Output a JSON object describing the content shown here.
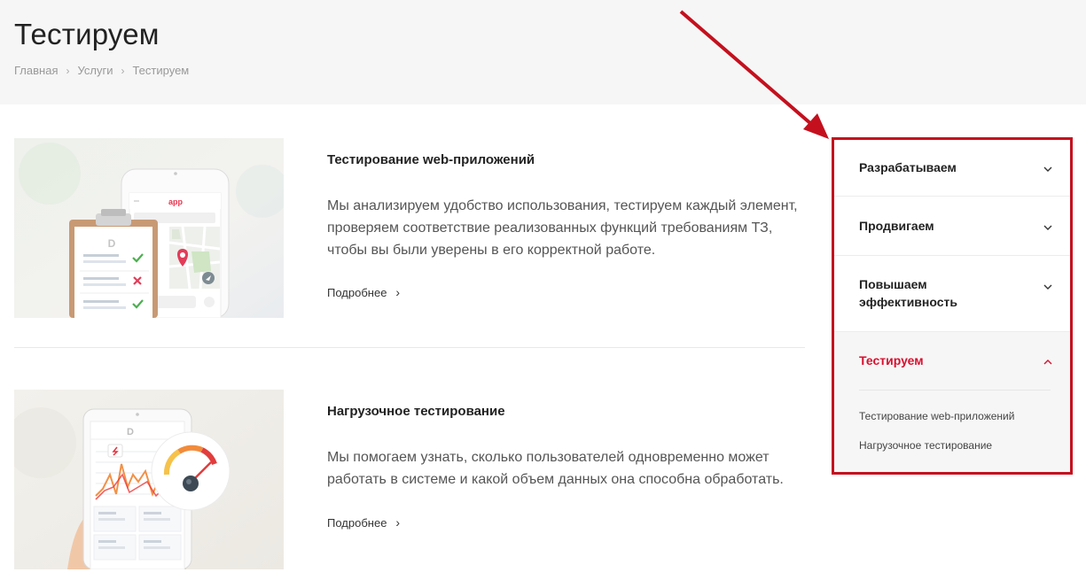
{
  "page": {
    "title": "Тестируем",
    "breadcrumb": [
      "Главная",
      "Услуги",
      "Тестируем"
    ]
  },
  "cards": [
    {
      "title": "Тестирование web-приложений",
      "description": "Мы анализируем удобство использования, тестируем каждый элемент, проверяем соответствие реализованных функций требованиям ТЗ, чтобы вы были уверены в его корректной работе.",
      "more_label": "Подробнее",
      "image_text": "app"
    },
    {
      "title": "Нагрузочное тестирование",
      "description": "Мы помогаем узнать, сколько пользователей одновременно может работать в системе и какой объем данных она способна обработать.",
      "more_label": "Подробнее"
    }
  ],
  "sidebar": {
    "items": [
      {
        "label": "Разрабатываем",
        "expanded": false
      },
      {
        "label": "Продвигаем",
        "expanded": false
      },
      {
        "label": "Повышаем эффективность",
        "expanded": false
      },
      {
        "label": "Тестируем",
        "expanded": true
      }
    ],
    "sub_items": [
      "Тестирование web-приложений",
      "Нагрузочное тестирование"
    ]
  },
  "colors": {
    "accent": "#d8102f",
    "highlight_box": "#c4101e",
    "header_bg": "#f6f6f6"
  }
}
